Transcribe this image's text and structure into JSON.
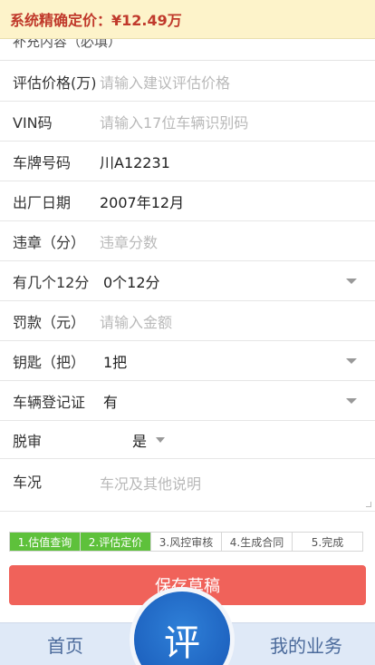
{
  "banner": {
    "text": "系统精确定价：¥12.49万"
  },
  "section_head": {
    "text": "补充内容（必填）"
  },
  "form": {
    "price": {
      "label": "评估价格(万)",
      "placeholder": "请输入建议评估价格"
    },
    "vin": {
      "label": "VIN码",
      "placeholder": "请输入17位车辆识别码"
    },
    "plate": {
      "label": "车牌号码",
      "value": "川A12231"
    },
    "manufacture_date": {
      "label": "出厂日期",
      "value": "2007年12月"
    },
    "violation_points": {
      "label": "违章（分）",
      "placeholder": "违章分数"
    },
    "twelve_points": {
      "label": "有几个12分",
      "value": "0个12分"
    },
    "fine": {
      "label": "罚款（元）",
      "placeholder": "请输入金额"
    },
    "keys": {
      "label": "钥匙（把）",
      "value": "1把"
    },
    "registration_cert": {
      "label": "车辆登记证",
      "value": "有"
    },
    "inspection_lapsed": {
      "label": "脱审",
      "value": "是"
    },
    "condition": {
      "label": "车况",
      "placeholder": "车况及其他说明"
    }
  },
  "steps": [
    {
      "label": "1.估值查询",
      "state": "done"
    },
    {
      "label": "2.评估定价",
      "state": "done"
    },
    {
      "label": "3.风控审核",
      "state": "pending"
    },
    {
      "label": "4.生成合同",
      "state": "pending"
    },
    {
      "label": "5.完成",
      "state": "pending"
    }
  ],
  "actions": {
    "save_label": "保存草稿"
  },
  "bottom_nav": {
    "home": "首页",
    "center": "评",
    "mine": "我的业务"
  },
  "colors": {
    "banner_bg": "#fdf3ca",
    "banner_text": "#c0392b",
    "step_done": "#5ec13b",
    "save_button": "#f0625a",
    "bottom_bar": "#dfe9f7",
    "fab": "#1e63c0"
  }
}
